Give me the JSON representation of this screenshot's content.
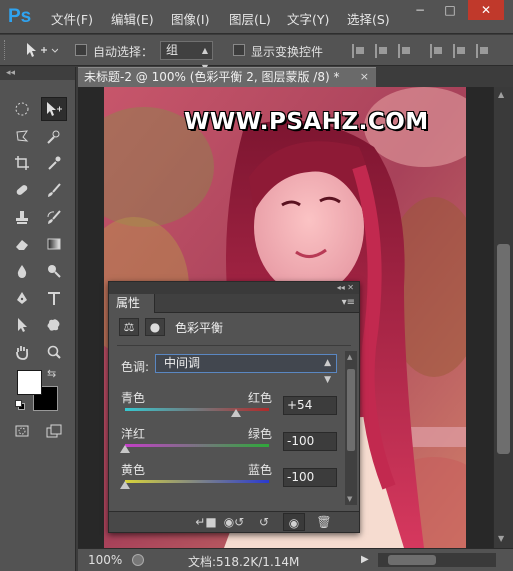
{
  "app": {
    "logo": "Ps",
    "menu": [
      "文件(F)",
      "编辑(E)",
      "图像(I)",
      "图层(L)",
      "文字(Y)",
      "选择(S)"
    ],
    "window_buttons": [
      "−",
      "□",
      "✕"
    ]
  },
  "options_bar": {
    "auto_select_label": "自动选择：",
    "auto_select_value": "组",
    "show_transform_label": "显示变换控件"
  },
  "document": {
    "tab_title": "未标题-2 @ 100% (色彩平衡 2, 图层蒙版 /8) *",
    "tab_close": "×",
    "watermark": "WWW.PSAHZ.COM"
  },
  "status": {
    "zoom": "100%",
    "doc_info": "文档:518.2K/1.14M"
  },
  "properties": {
    "tab_label": "属性",
    "adjustment_title": "色彩平衡",
    "tone_label": "色调:",
    "tone_value": "中间调",
    "sliders": [
      {
        "left": "青色",
        "right": "红色",
        "value": "+54",
        "level": 54
      },
      {
        "left": "洋红",
        "right": "绿色",
        "value": "-100",
        "level": -100
      },
      {
        "left": "黄色",
        "right": "蓝色",
        "value": "-100",
        "level": -100
      }
    ]
  },
  "colors": {
    "accent_blue": "#2fa3f0",
    "foreground": "#ffffff",
    "background": "#000000"
  }
}
